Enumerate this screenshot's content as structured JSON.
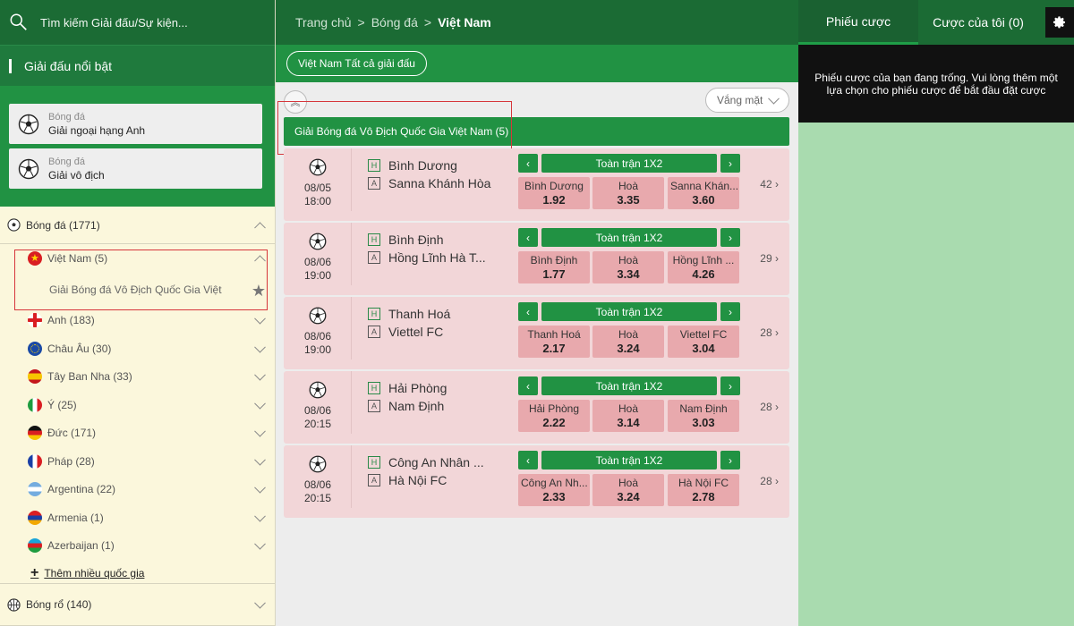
{
  "search": {
    "placeholder": "Tìm kiếm Giải đấu/Sự kiện..."
  },
  "featured": {
    "title": "Giải đấu nổi bật",
    "cards": [
      {
        "sport": "Bóng đá",
        "league": "Giải ngoại hạng Anh"
      },
      {
        "sport": "Bóng đá",
        "league": "Giải vô địch"
      }
    ]
  },
  "sports": {
    "football": "Bóng đá (1771)",
    "basketball": "Bóng rổ (140)"
  },
  "countries": [
    {
      "label": "Việt Nam (5)",
      "flag": "vietnam"
    },
    {
      "label": "Anh (183)",
      "flag": "england"
    },
    {
      "label": "Châu Âu (30)",
      "flag": "europe"
    },
    {
      "label": "Tây Ban Nha (33)",
      "flag": "spain"
    },
    {
      "label": "Ý (25)",
      "flag": "italy"
    },
    {
      "label": "Đức (171)",
      "flag": "germany"
    },
    {
      "label": "Pháp (28)",
      "flag": "france"
    },
    {
      "label": "Argentina (22)",
      "flag": "argentina"
    },
    {
      "label": "Armenia (1)",
      "flag": "armenia"
    },
    {
      "label": "Azerbaijan (1)",
      "flag": "azerbaijan"
    }
  ],
  "vn_league": "Giải Bóng đá Vô Địch Quốc Gia Việt Nam",
  "more_countries": "Thêm nhiều quốc gia",
  "breadcrumb": {
    "home": "Trang chủ",
    "sport": "Bóng đá",
    "current": "Việt Nam",
    "sep": ">"
  },
  "pill": "Việt Nam Tất cả giải đấu",
  "absent": "Vắng mặt",
  "league_bar": "Giải Bóng đá Vô Địch Quốc Gia Việt Nam (5)",
  "market_title": "Toàn trận 1X2",
  "matches": [
    {
      "date": "08/05",
      "time": "18:00",
      "home": "Bình Dương",
      "away": "Sanna Khánh Hòa",
      "odds": [
        {
          "n": "Bình Dương",
          "v": "1.92"
        },
        {
          "n": "Hoà",
          "v": "3.35"
        },
        {
          "n": "Sanna Khán...",
          "v": "3.60"
        }
      ],
      "more": "42"
    },
    {
      "date": "08/06",
      "time": "19:00",
      "home": "Bình Định",
      "away": "Hồng Lĩnh Hà T...",
      "odds": [
        {
          "n": "Bình Định",
          "v": "1.77"
        },
        {
          "n": "Hoà",
          "v": "3.34"
        },
        {
          "n": "Hồng Lĩnh ...",
          "v": "4.26"
        }
      ],
      "more": "29"
    },
    {
      "date": "08/06",
      "time": "19:00",
      "home": "Thanh Hoá",
      "away": "Viettel FC",
      "odds": [
        {
          "n": "Thanh Hoá",
          "v": "2.17"
        },
        {
          "n": "Hoà",
          "v": "3.24"
        },
        {
          "n": "Viettel FC",
          "v": "3.04"
        }
      ],
      "more": "28"
    },
    {
      "date": "08/06",
      "time": "20:15",
      "home": "Hải Phòng",
      "away": "Nam Định",
      "odds": [
        {
          "n": "Hải Phòng",
          "v": "2.22"
        },
        {
          "n": "Hoà",
          "v": "3.14"
        },
        {
          "n": "Nam Định",
          "v": "3.03"
        }
      ],
      "more": "28"
    },
    {
      "date": "08/06",
      "time": "20:15",
      "home": "Công An Nhân ...",
      "away": "Hà Nội FC",
      "odds": [
        {
          "n": "Công An Nh...",
          "v": "2.33"
        },
        {
          "n": "Hoà",
          "v": "3.24"
        },
        {
          "n": "Hà Nội FC",
          "v": "2.78"
        }
      ],
      "more": "28"
    }
  ],
  "right": {
    "tab_slip": "Phiếu cược",
    "tab_mybets": "Cược của tôi (0)",
    "empty": "Phiếu cược của bạn đang trống. Vui lòng thêm một lựa chọn cho phiếu cược để bắt đầu đặt cược"
  },
  "colors": {
    "dark_green": "#1b6b34",
    "green": "#219243",
    "odds_pink": "#e8a9ad",
    "row_pink": "#f2d6d8",
    "right_bg": "#a9dbaf",
    "highlight_red": "#d6363b"
  }
}
